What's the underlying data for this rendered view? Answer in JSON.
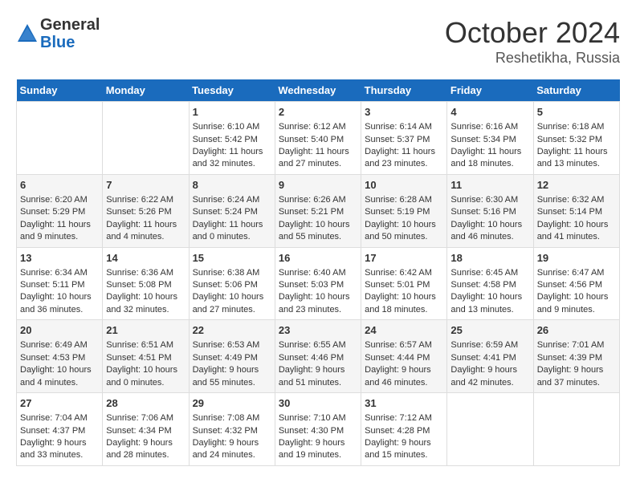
{
  "header": {
    "logo_general": "General",
    "logo_blue": "Blue",
    "month": "October 2024",
    "location": "Reshetikha, Russia"
  },
  "days_of_week": [
    "Sunday",
    "Monday",
    "Tuesday",
    "Wednesday",
    "Thursday",
    "Friday",
    "Saturday"
  ],
  "weeks": [
    [
      {
        "day": "",
        "info": ""
      },
      {
        "day": "",
        "info": ""
      },
      {
        "day": "1",
        "info": "Sunrise: 6:10 AM\nSunset: 5:42 PM\nDaylight: 11 hours and 32 minutes."
      },
      {
        "day": "2",
        "info": "Sunrise: 6:12 AM\nSunset: 5:40 PM\nDaylight: 11 hours and 27 minutes."
      },
      {
        "day": "3",
        "info": "Sunrise: 6:14 AM\nSunset: 5:37 PM\nDaylight: 11 hours and 23 minutes."
      },
      {
        "day": "4",
        "info": "Sunrise: 6:16 AM\nSunset: 5:34 PM\nDaylight: 11 hours and 18 minutes."
      },
      {
        "day": "5",
        "info": "Sunrise: 6:18 AM\nSunset: 5:32 PM\nDaylight: 11 hours and 13 minutes."
      }
    ],
    [
      {
        "day": "6",
        "info": "Sunrise: 6:20 AM\nSunset: 5:29 PM\nDaylight: 11 hours and 9 minutes."
      },
      {
        "day": "7",
        "info": "Sunrise: 6:22 AM\nSunset: 5:26 PM\nDaylight: 11 hours and 4 minutes."
      },
      {
        "day": "8",
        "info": "Sunrise: 6:24 AM\nSunset: 5:24 PM\nDaylight: 11 hours and 0 minutes."
      },
      {
        "day": "9",
        "info": "Sunrise: 6:26 AM\nSunset: 5:21 PM\nDaylight: 10 hours and 55 minutes."
      },
      {
        "day": "10",
        "info": "Sunrise: 6:28 AM\nSunset: 5:19 PM\nDaylight: 10 hours and 50 minutes."
      },
      {
        "day": "11",
        "info": "Sunrise: 6:30 AM\nSunset: 5:16 PM\nDaylight: 10 hours and 46 minutes."
      },
      {
        "day": "12",
        "info": "Sunrise: 6:32 AM\nSunset: 5:14 PM\nDaylight: 10 hours and 41 minutes."
      }
    ],
    [
      {
        "day": "13",
        "info": "Sunrise: 6:34 AM\nSunset: 5:11 PM\nDaylight: 10 hours and 36 minutes."
      },
      {
        "day": "14",
        "info": "Sunrise: 6:36 AM\nSunset: 5:08 PM\nDaylight: 10 hours and 32 minutes."
      },
      {
        "day": "15",
        "info": "Sunrise: 6:38 AM\nSunset: 5:06 PM\nDaylight: 10 hours and 27 minutes."
      },
      {
        "day": "16",
        "info": "Sunrise: 6:40 AM\nSunset: 5:03 PM\nDaylight: 10 hours and 23 minutes."
      },
      {
        "day": "17",
        "info": "Sunrise: 6:42 AM\nSunset: 5:01 PM\nDaylight: 10 hours and 18 minutes."
      },
      {
        "day": "18",
        "info": "Sunrise: 6:45 AM\nSunset: 4:58 PM\nDaylight: 10 hours and 13 minutes."
      },
      {
        "day": "19",
        "info": "Sunrise: 6:47 AM\nSunset: 4:56 PM\nDaylight: 10 hours and 9 minutes."
      }
    ],
    [
      {
        "day": "20",
        "info": "Sunrise: 6:49 AM\nSunset: 4:53 PM\nDaylight: 10 hours and 4 minutes."
      },
      {
        "day": "21",
        "info": "Sunrise: 6:51 AM\nSunset: 4:51 PM\nDaylight: 10 hours and 0 minutes."
      },
      {
        "day": "22",
        "info": "Sunrise: 6:53 AM\nSunset: 4:49 PM\nDaylight: 9 hours and 55 minutes."
      },
      {
        "day": "23",
        "info": "Sunrise: 6:55 AM\nSunset: 4:46 PM\nDaylight: 9 hours and 51 minutes."
      },
      {
        "day": "24",
        "info": "Sunrise: 6:57 AM\nSunset: 4:44 PM\nDaylight: 9 hours and 46 minutes."
      },
      {
        "day": "25",
        "info": "Sunrise: 6:59 AM\nSunset: 4:41 PM\nDaylight: 9 hours and 42 minutes."
      },
      {
        "day": "26",
        "info": "Sunrise: 7:01 AM\nSunset: 4:39 PM\nDaylight: 9 hours and 37 minutes."
      }
    ],
    [
      {
        "day": "27",
        "info": "Sunrise: 7:04 AM\nSunset: 4:37 PM\nDaylight: 9 hours and 33 minutes."
      },
      {
        "day": "28",
        "info": "Sunrise: 7:06 AM\nSunset: 4:34 PM\nDaylight: 9 hours and 28 minutes."
      },
      {
        "day": "29",
        "info": "Sunrise: 7:08 AM\nSunset: 4:32 PM\nDaylight: 9 hours and 24 minutes."
      },
      {
        "day": "30",
        "info": "Sunrise: 7:10 AM\nSunset: 4:30 PM\nDaylight: 9 hours and 19 minutes."
      },
      {
        "day": "31",
        "info": "Sunrise: 7:12 AM\nSunset: 4:28 PM\nDaylight: 9 hours and 15 minutes."
      },
      {
        "day": "",
        "info": ""
      },
      {
        "day": "",
        "info": ""
      }
    ]
  ]
}
